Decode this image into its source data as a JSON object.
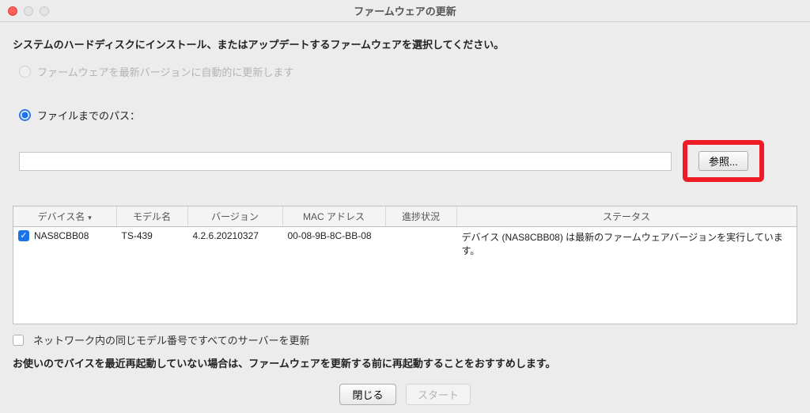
{
  "window": {
    "title": "ファームウェアの更新"
  },
  "instruction": "システムのハードディスクにインストール、またはアップデートするファームウェアを選択してください。",
  "options": {
    "auto_update_label": "ファームウェアを最新バージョンに自動的に更新します",
    "file_path_label": "ファイルまでのパス："
  },
  "path_input": {
    "value": ""
  },
  "browse_label": "参照...",
  "table": {
    "headers": {
      "device": "デバイス名",
      "model": "モデル名",
      "version": "バージョン",
      "mac": "MAC アドレス",
      "progress": "進捗状況",
      "status": "ステータス"
    },
    "rows": [
      {
        "checked": true,
        "device": "NAS8CBB08",
        "model": "TS-439",
        "version": "4.2.6.20210327",
        "mac": "00-08-9B-8C-BB-08",
        "progress": "",
        "status": "デバイス (NAS8CBB08) は最新のファームウェアバージョンを実行しています。"
      }
    ]
  },
  "same_model_label": "ネットワーク内の同じモデル番号ですべてのサーバーを更新",
  "advice": "お使いのでバイスを最近再起動していない場合は、ファームウェアを更新する前に再起動することをおすすめします。",
  "buttons": {
    "close": "閉じる",
    "start": "スタート"
  }
}
